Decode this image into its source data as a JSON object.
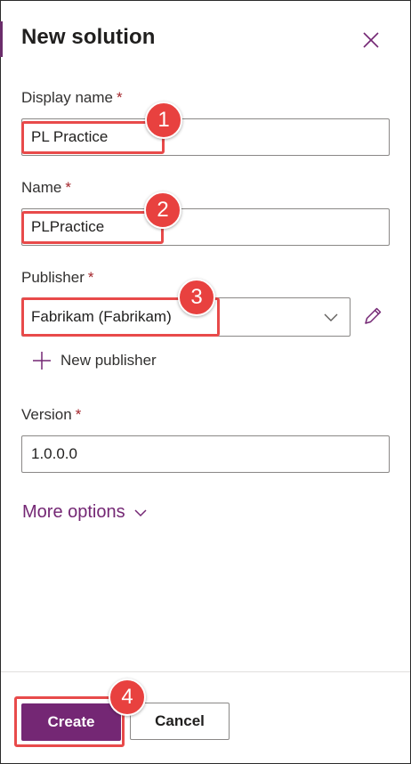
{
  "dialog": {
    "title": "New solution",
    "required_marker": "*"
  },
  "fields": {
    "display_name": {
      "label": "Display name",
      "value": "PL Practice"
    },
    "name": {
      "label": "Name",
      "value": "PLPractice"
    },
    "publisher": {
      "label": "Publisher",
      "value": "Fabrikam (Fabrikam)",
      "new_label": "New publisher"
    },
    "version": {
      "label": "Version",
      "value": "1.0.0.0"
    }
  },
  "more_options": {
    "label": "More options"
  },
  "buttons": {
    "create": "Create",
    "cancel": "Cancel"
  },
  "callouts": [
    "1",
    "2",
    "3",
    "4"
  ],
  "colors": {
    "accent": "#742774",
    "highlight": "#e84a4a",
    "required": "#a4262c"
  },
  "icons": [
    "close-icon",
    "chevron-down-icon",
    "edit-pencil-icon",
    "plus-icon"
  ]
}
